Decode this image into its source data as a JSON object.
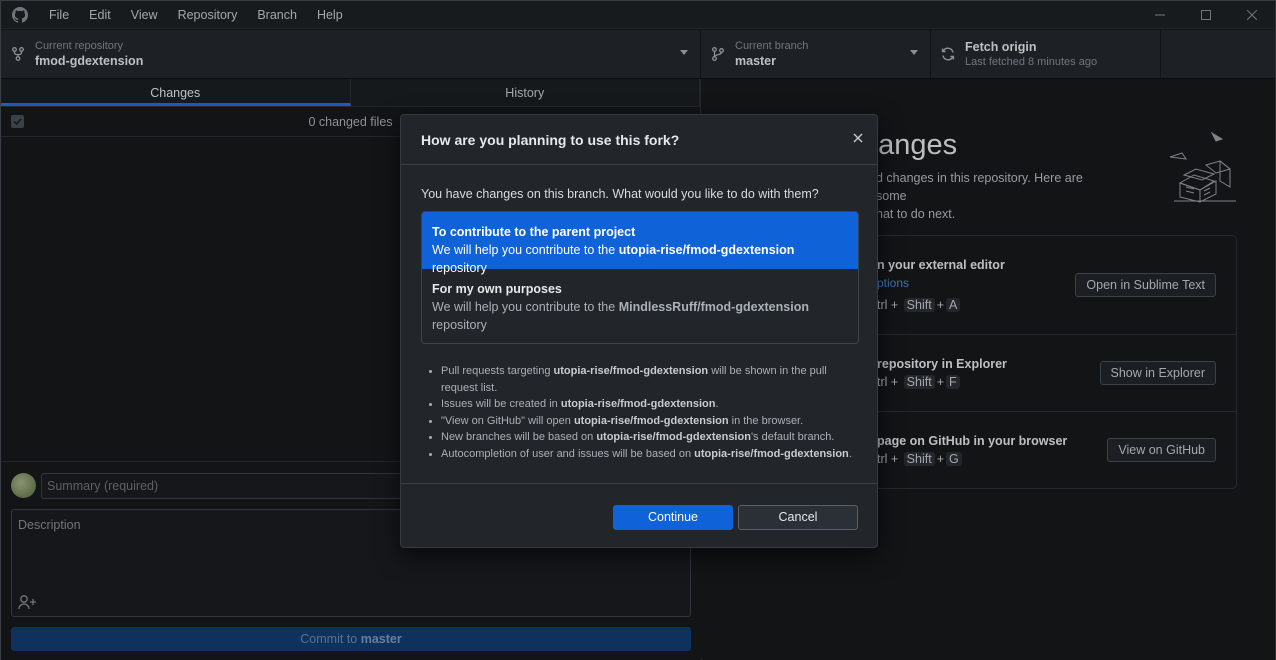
{
  "menu": [
    "File",
    "Edit",
    "View",
    "Repository",
    "Branch",
    "Help"
  ],
  "toolbar": {
    "repo_label": "Current repository",
    "repo_name": "fmod-gdextension",
    "branch_label": "Current branch",
    "branch_name": "master",
    "fetch_label": "Fetch origin",
    "fetch_sub": "Last fetched 8 minutes ago"
  },
  "tabs": {
    "changes": "Changes",
    "history": "History"
  },
  "changes_count": "0 changed files",
  "commit": {
    "summary_placeholder": "Summary (required)",
    "description_placeholder": "Description",
    "button_prefix": "Commit to ",
    "button_branch": "master"
  },
  "right": {
    "title": "hanges",
    "body_line1": "d changes in this repository. Here are some",
    "body_line2": "hat to do next.",
    "actions": [
      {
        "title": "n your external editor",
        "sub": "ptions",
        "keys_prefix": "trl",
        "keys": [
          "Shift",
          "A"
        ],
        "button": "Open in Sublime Text"
      },
      {
        "title": "repository in Explorer",
        "sub": "",
        "keys_prefix": "trl",
        "keys": [
          "Shift",
          "F"
        ],
        "button": "Show in Explorer"
      },
      {
        "title": "page on GitHub in your browser",
        "sub": "",
        "keys_prefix": "trl",
        "keys": [
          "Shift",
          "G"
        ],
        "button": "View on GitHub"
      }
    ]
  },
  "dialog": {
    "title": "How are you planning to use this fork?",
    "prompt": "You have changes on this branch. What would you like to do with them?",
    "option1": {
      "title": "To contribute to the parent project",
      "desc_prefix": "We will help you contribute to the ",
      "desc_repo": "utopia-rise/fmod-gdextension",
      "desc_suffix": " repository"
    },
    "option2": {
      "title": "For my own purposes",
      "desc_prefix": "We will help you contribute to the ",
      "desc_repo": "MindlessRuff/fmod-gdextension",
      "desc_suffix": "repository"
    },
    "bullets": [
      {
        "pre": "Pull requests targeting ",
        "bold": "utopia-rise/fmod-gdextension",
        "post": " will be shown in the pull request list."
      },
      {
        "pre": "Issues will be created in ",
        "bold": "utopia-rise/fmod-gdextension",
        "post": "."
      },
      {
        "pre": "\"View on GitHub\" will open ",
        "bold": "utopia-rise/fmod-gdextension",
        "post": " in the browser."
      },
      {
        "pre": "New branches will be based on ",
        "bold": "utopia-rise/fmod-gdextension",
        "post": "'s default branch."
      },
      {
        "pre": "Autocompletion of user and issues will be based on ",
        "bold": "utopia-rise/fmod-gdextension",
        "post": "."
      }
    ],
    "continue": "Continue",
    "cancel": "Cancel"
  },
  "icons": {
    "app": "github-logo-icon",
    "repo": "repo-fork-icon",
    "branch": "branch-icon",
    "fetch": "sync-icon",
    "close": "close-icon"
  },
  "colors": {
    "accent": "#0f62d8",
    "background": "#17191c"
  }
}
